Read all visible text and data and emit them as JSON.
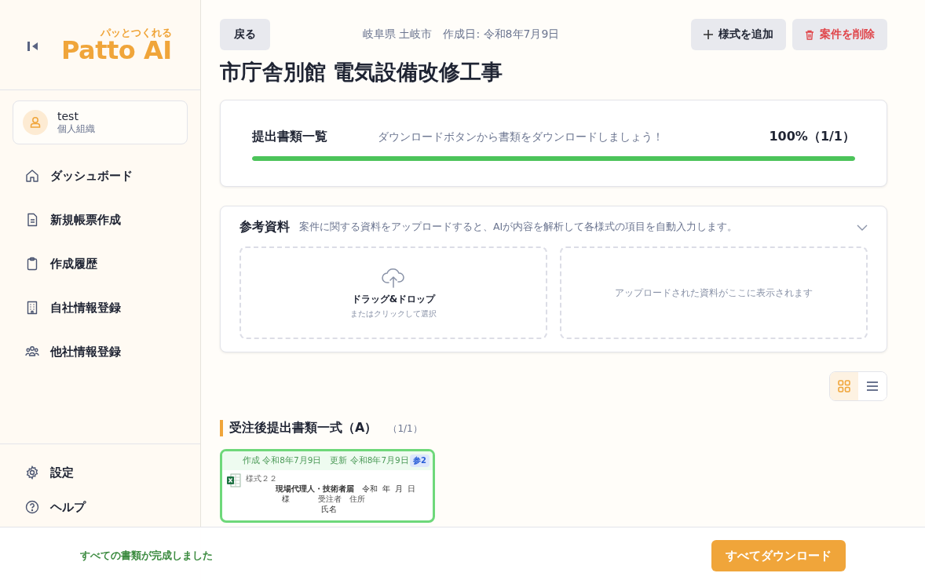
{
  "sidebar": {
    "logo": {
      "tagline": "パッとつくれる",
      "name": "Patto AI"
    },
    "account": {
      "name": "test",
      "org": "個人組織"
    },
    "nav": [
      {
        "label": "ダッシュボード"
      },
      {
        "label": "新規帳票作成"
      },
      {
        "label": "作成履歴"
      },
      {
        "label": "自社情報登録"
      },
      {
        "label": "他社情報登録"
      }
    ],
    "footer_nav": [
      {
        "label": "設定"
      },
      {
        "label": "ヘルプ"
      }
    ]
  },
  "header": {
    "back": "戻る",
    "location": "岐阜県 土岐市",
    "created": "作成日: 令和8年7月9日",
    "add_button": "様式を追加",
    "delete_button": "案件を削除"
  },
  "title": "市庁舎別館 電気設備改修工事",
  "progress": {
    "title": "提出書類一覧",
    "message": "ダウンロードボタンから書類をダウンロードしましょう！",
    "reading": "100%（1/1）",
    "level": 1
  },
  "reference": {
    "title": "参考資料",
    "description": "案件に関する資料をアップロードすると、AIが内容を解析して各様式の項目を自動入力します。",
    "upload_title": "ドラッグ&ドロップ",
    "upload_hint": "またはクリックして選択",
    "empty": "アップロードされた資料がここに表示されます"
  },
  "view_toggle": [
    {
      "kind": "grid",
      "selected": true
    },
    {
      "kind": "list",
      "selected": false
    }
  ],
  "section": {
    "title": "受注後提出書類一式（A）",
    "count": "（1/1）"
  },
  "documents": [
    {
      "created": "作成 令和8年7月9日",
      "updated": "更新 令和8年7月9日",
      "badge": "参2",
      "complete": true,
      "preview": {
        "form_no": "様式２２",
        "doc_title": "現場代理人・技術者届",
        "date": [
          "令和",
          "年",
          "月",
          "日"
        ],
        "addressee": "様",
        "contractor": "受注者　住所",
        "name": "氏名"
      }
    }
  ],
  "footer": {
    "status": "すべての書類が完成しました",
    "button": "すべてダウンロード"
  }
}
